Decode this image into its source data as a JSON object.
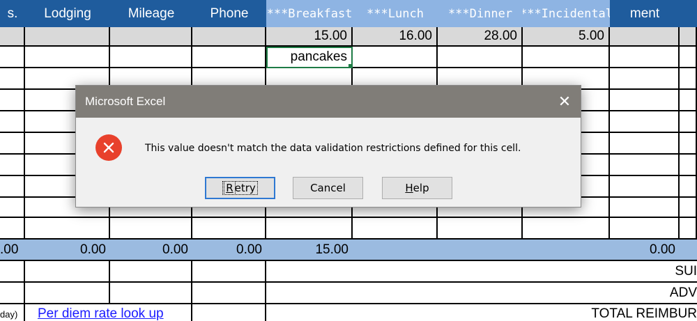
{
  "headers": [
    "s.",
    "Lodging",
    "Mileage",
    "Phone",
    "***Breakfast",
    "***Lunch",
    "***Dinner",
    "***Incidental",
    "ment"
  ],
  "rates": [
    "15.00",
    "16.00",
    "28.00",
    "5.00"
  ],
  "active_cell_value": "pancakes",
  "totals": [
    ".00",
    "0.00",
    "0.00",
    "0.00",
    "15.00",
    "0.00"
  ],
  "summary_labels": [
    "SUI",
    "ADV",
    "TOTAL REIMBUR"
  ],
  "footer": {
    "left_fragment": "day)",
    "link": "Per diem rate look up"
  },
  "dialog": {
    "title": "Microsoft Excel",
    "close_glyph": "✕",
    "message": "This value doesn't match the data validation restrictions defined for this cell.",
    "buttons": {
      "retry": "Retry",
      "cancel": "Cancel",
      "help": "Help"
    }
  },
  "colors": {
    "header_dark": "#1f5c9d",
    "header_light": "#8eb4e3",
    "totals_row": "#9bbbe0",
    "error_icon": "#e8412c",
    "titlebar": "#807d78"
  }
}
